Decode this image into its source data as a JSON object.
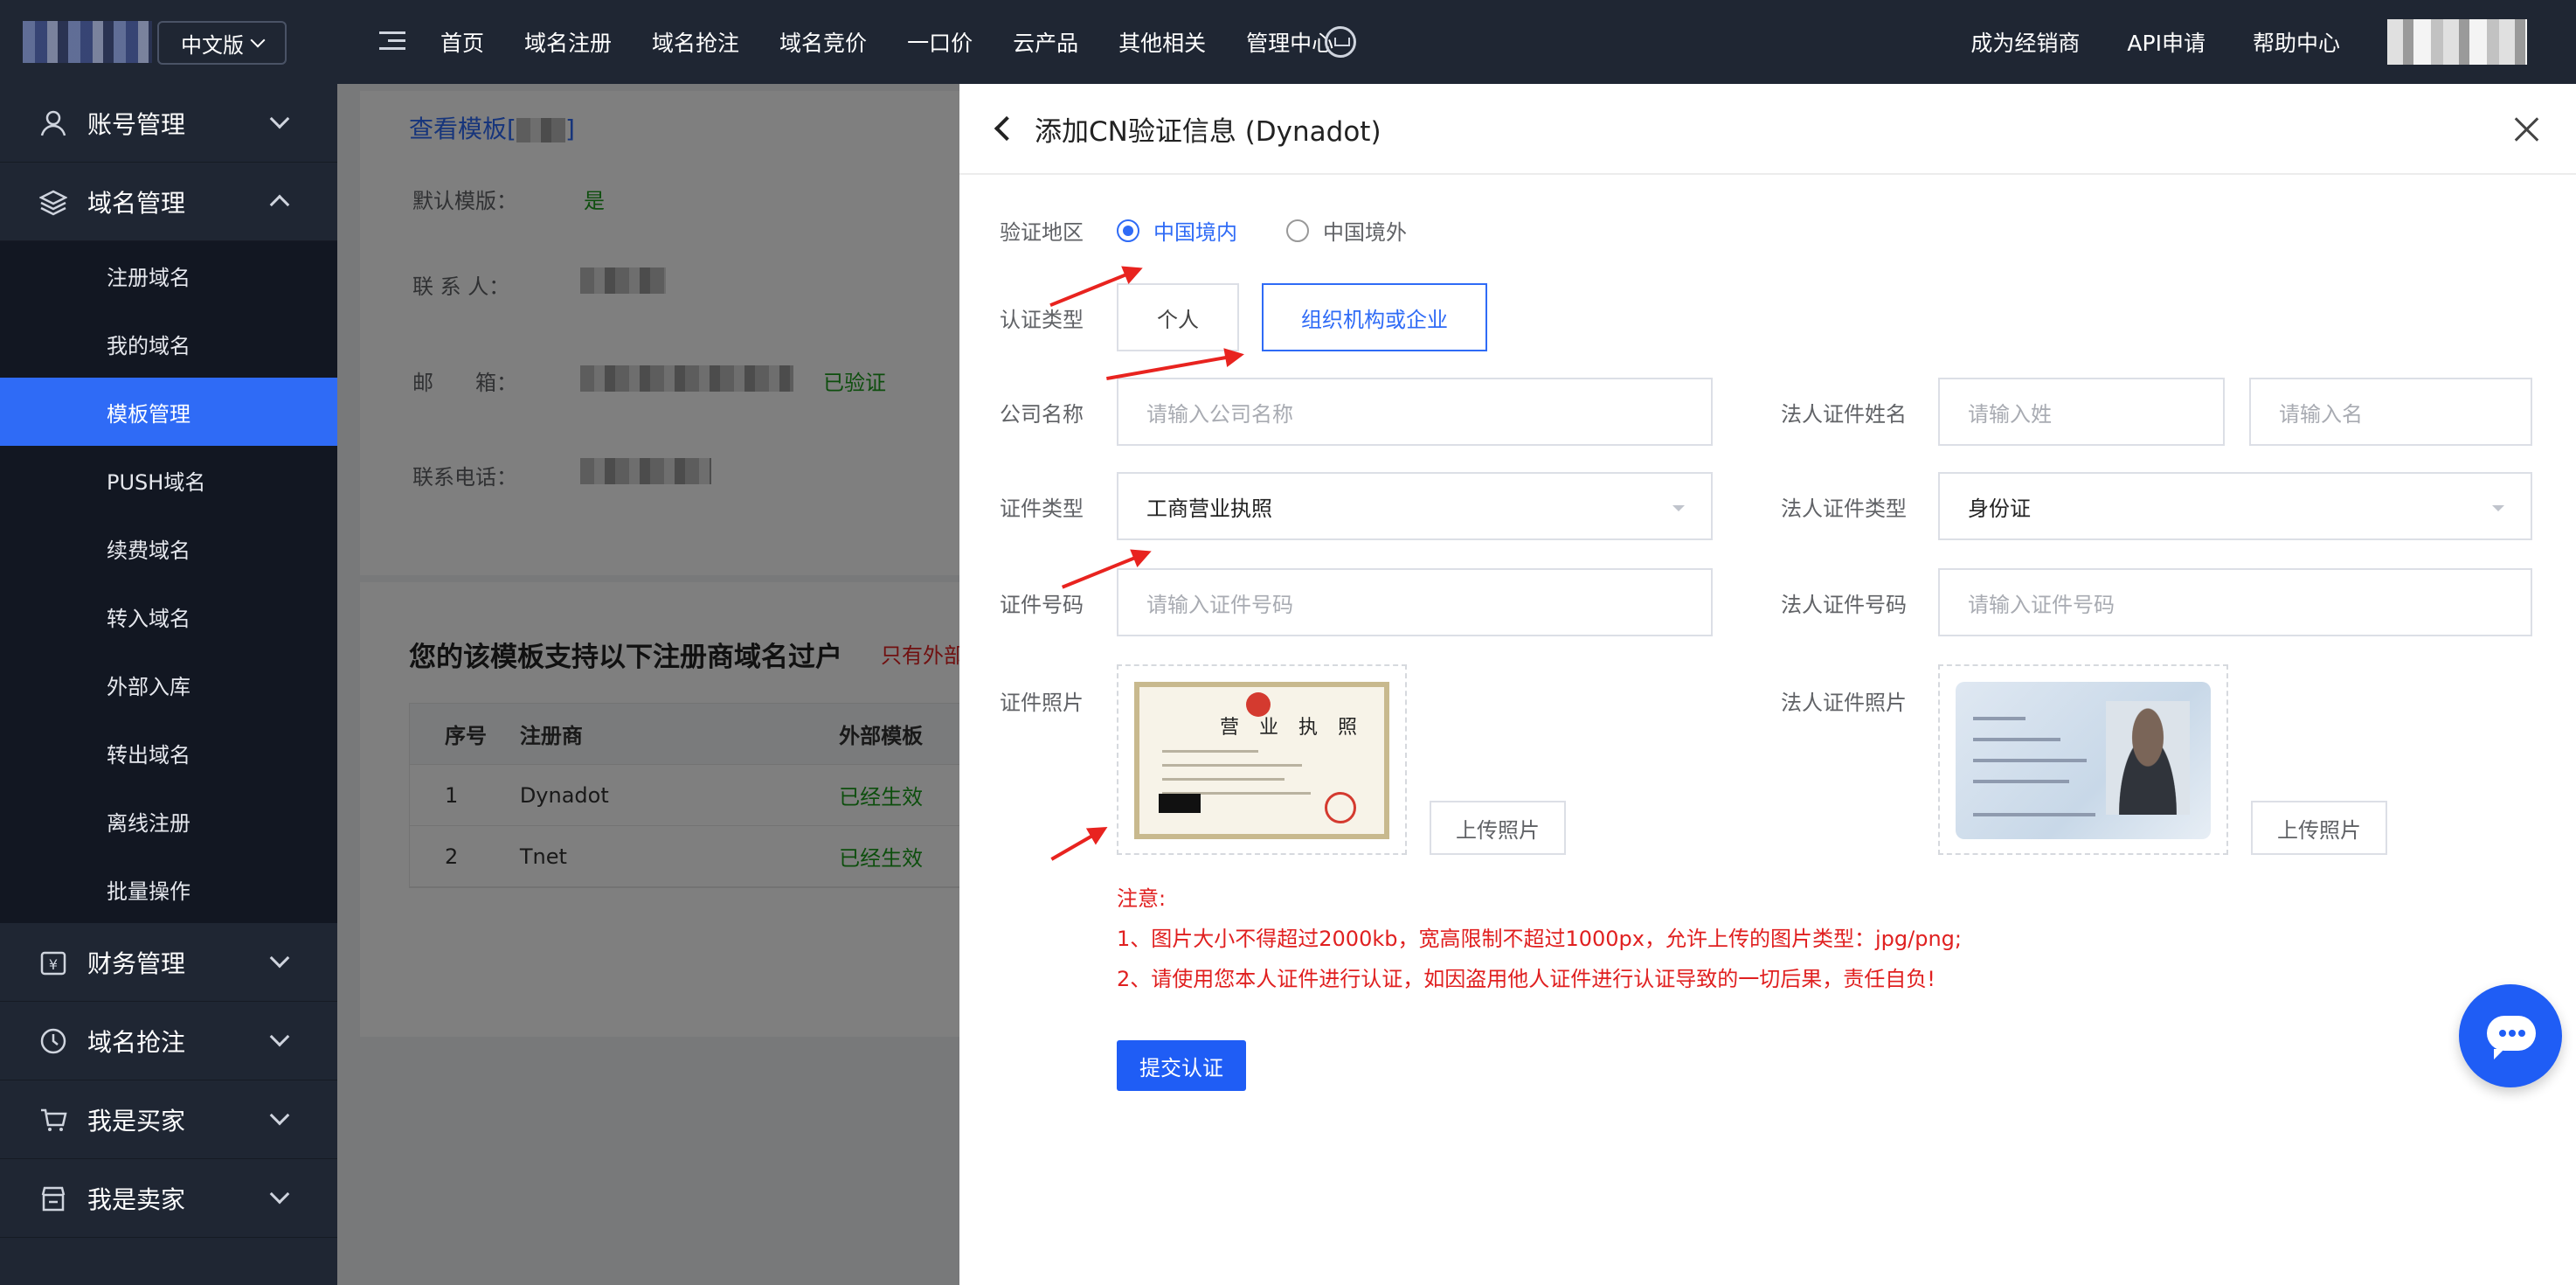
{
  "topbar": {
    "lang": "中文版",
    "nav": [
      "首页",
      "域名注册",
      "域名抢注",
      "域名竞价",
      "一口价",
      "云产品",
      "其他相关",
      "管理中心"
    ],
    "right_nav": [
      "成为经销商",
      "API申请",
      "帮助中心"
    ]
  },
  "sidebar": {
    "groups_top": [
      {
        "label": "账号管理",
        "icon": "user-icon",
        "expanded": false
      },
      {
        "label": "域名管理",
        "icon": "layers-icon",
        "expanded": true
      }
    ],
    "sub_items": [
      "注册域名",
      "我的域名",
      "模板管理",
      "PUSH域名",
      "续费域名",
      "转入域名",
      "外部入库",
      "转出域名",
      "离线注册",
      "批量操作"
    ],
    "active_sub": "模板管理",
    "groups_bottom": [
      {
        "label": "财务管理",
        "icon": "yen-icon"
      },
      {
        "label": "域名抢注",
        "icon": "clock-icon"
      },
      {
        "label": "我是买家",
        "icon": "cart-icon"
      },
      {
        "label": "我是卖家",
        "icon": "shop-icon"
      }
    ]
  },
  "background_page": {
    "title": "查看模板[",
    "title_end": "]",
    "default_label": "默认模版：",
    "default_value": "是",
    "contact_label": "联 系 人：",
    "email_label": "邮　　箱：",
    "email_status": "已验证",
    "phone_label": "联系电话：",
    "table_title": "您的该模板支持以下注册商域名过户",
    "table_warn": "只有外部",
    "columns": [
      "序号",
      "注册商",
      "外部模板"
    ],
    "rows": [
      {
        "no": "1",
        "registrar": "Dynadot",
        "status": "已经生效"
      },
      {
        "no": "2",
        "registrar": "Tnet",
        "status": "已经生效"
      }
    ]
  },
  "drawer": {
    "title": "添加CN验证信息 (Dynadot)",
    "region_label": "验证地区",
    "region_options": [
      "中国境内",
      "中国境外"
    ],
    "region_selected": "中国境内",
    "type_label": "认证类型",
    "type_options": [
      "个人",
      "组织机构或企业"
    ],
    "type_selected": "组织机构或企业",
    "company_label": "公司名称",
    "company_placeholder": "请输入公司名称",
    "legal_name_label": "法人证件姓名",
    "surname_placeholder": "请输入姓",
    "given_placeholder": "请输入名",
    "cert_type_label": "证件类型",
    "cert_type_value": "工商营业执照",
    "legal_cert_type_label": "法人证件类型",
    "legal_cert_type_value": "身份证",
    "cert_no_label": "证件号码",
    "cert_no_placeholder": "请输入证件号码",
    "legal_cert_no_label": "法人证件号码",
    "legal_cert_no_placeholder": "请输入证件号码",
    "cert_photo_label": "证件照片",
    "legal_photo_label": "法人证件照片",
    "upload_label": "上传照片",
    "license_text": "营 业 执 照",
    "notice_title": "注意:",
    "notice_1": "1、图片大小不得超过2000kb，宽高限制不超过1000px，允许上传的图片类型：jpg/png;",
    "notice_2": "2、请使用您本人证件进行认证，如因盗用他人证件进行认证导致的一切后果，责任自负!",
    "submit_label": "提交认证"
  },
  "colors": {
    "accent": "#2f6bf6",
    "dark": "#1f2633",
    "danger": "#e02020",
    "success": "#1b9d1b"
  }
}
